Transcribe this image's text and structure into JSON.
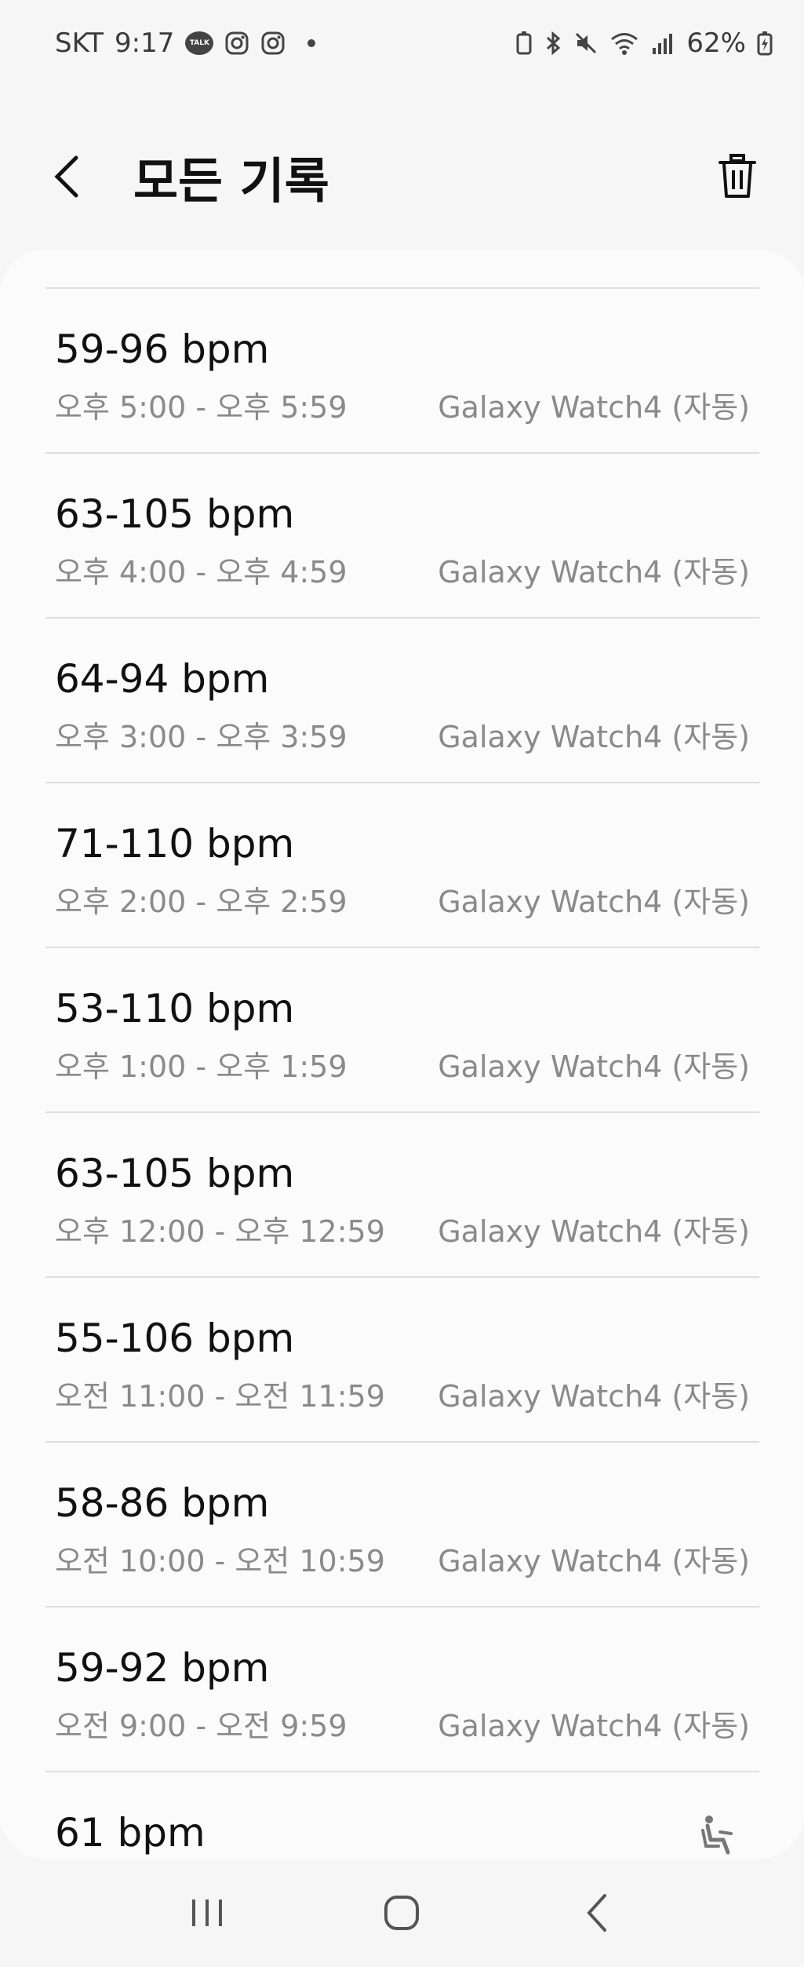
{
  "status_bar": {
    "carrier": "SKT",
    "time": "9:17",
    "talk_icon_text": "TALK",
    "battery": "62%"
  },
  "header": {
    "title": "모든 기록"
  },
  "records": [
    {
      "bpm": "59-96 bpm",
      "time": "오후 5:00 - 오후 5:59",
      "device": "Galaxy Watch4 (자동)"
    },
    {
      "bpm": "63-105 bpm",
      "time": "오후 4:00 - 오후 4:59",
      "device": "Galaxy Watch4 (자동)"
    },
    {
      "bpm": "64-94 bpm",
      "time": "오후 3:00 - 오후 3:59",
      "device": "Galaxy Watch4 (자동)"
    },
    {
      "bpm": "71-110 bpm",
      "time": "오후 2:00 - 오후 2:59",
      "device": "Galaxy Watch4 (자동)"
    },
    {
      "bpm": "53-110 bpm",
      "time": "오후 1:00 - 오후 1:59",
      "device": "Galaxy Watch4 (자동)"
    },
    {
      "bpm": "63-105 bpm",
      "time": "오후 12:00 - 오후 12:59",
      "device": "Galaxy Watch4 (자동)"
    },
    {
      "bpm": "55-106 bpm",
      "time": "오전 11:00 - 오전 11:59",
      "device": "Galaxy Watch4 (자동)"
    },
    {
      "bpm": "58-86 bpm",
      "time": "오전 10:00 - 오전 10:59",
      "device": "Galaxy Watch4 (자동)"
    },
    {
      "bpm": "59-92 bpm",
      "time": "오전 9:00 - 오전 9:59",
      "device": "Galaxy Watch4 (자동)"
    },
    {
      "bpm": "61 bpm",
      "time": "",
      "device": ""
    }
  ],
  "icons": {
    "back": "back-arrow-icon",
    "trash": "trash-icon",
    "resting": "seated-person-icon",
    "nav_recent": "recent-apps-icon",
    "nav_home": "home-icon",
    "nav_back": "nav-back-icon"
  },
  "colors": {
    "background": "#f6f6f6",
    "card": "#fbfbfb",
    "primary_text": "#111111",
    "secondary_text": "#8a8a8a",
    "divider": "#dedede"
  }
}
